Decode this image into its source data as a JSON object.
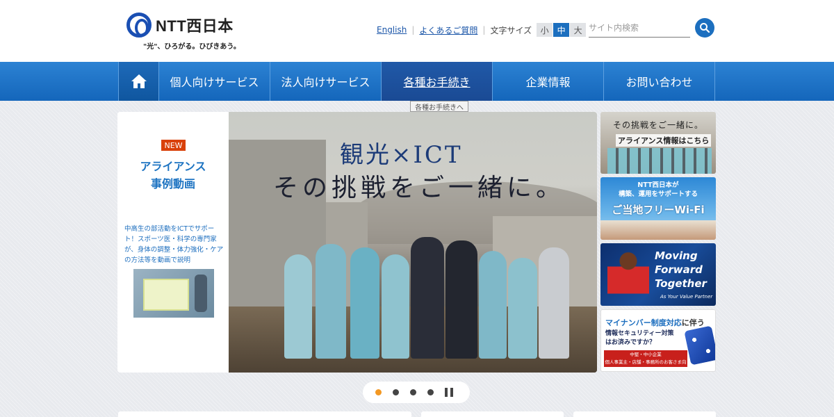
{
  "header": {
    "logo_text": "NTT西日本",
    "tagline": "\"光\"、ひろがる。ひびきあう。",
    "links": {
      "english": "English",
      "faq": "よくあるご質問"
    },
    "font_size": {
      "label": "文字サイズ",
      "small": "小",
      "medium": "中",
      "large": "大",
      "selected": "中"
    },
    "search": {
      "placeholder": "サイト内検索",
      "icon": "search-icon"
    }
  },
  "nav": {
    "home_icon": "home-icon",
    "items": [
      "個人向けサービス",
      "法人向けサービス",
      "各種お手続き",
      "企業情報",
      "お問い合わせ"
    ],
    "active_item": "各種お手続き",
    "tooltip": "各種お手続きへ"
  },
  "hero": {
    "badge": "NEW",
    "title_line1": "アライアンス",
    "title_line2": "事例動画",
    "description": "中高生の部活動をICTでサポート！スポーツ医・科学の専門家が、身体の調整・体力強化・ケアの方法等を動画で説明",
    "headline1": "観光×ICT",
    "headline2": "その挑戦をご一緒に。"
  },
  "banners": [
    {
      "line1": "その挑戦をご一緒に。",
      "line2": "アライアンス情報はこちら"
    },
    {
      "line1": "NTT西日本が",
      "line2": "構築、運用をサポートする",
      "line3": "ご当地フリーWi-Fi"
    },
    {
      "line1": "Moving",
      "line2": "Forward",
      "line3": "Together",
      "line4": "As Your Value Partner"
    },
    {
      "line1a": "マイナンバー制度対応",
      "line1b": "に伴う",
      "line2": "情報セキュリティー対策",
      "line3": "はお済みですか？",
      "strip1": "中堅・中小企業",
      "strip2": "個人事業主・店舗・事務所のお客さま向け"
    }
  ],
  "pager": {
    "count": 4,
    "active_index": 0,
    "pause_icon": "pause-icon"
  },
  "colors": {
    "brand_blue": "#1c6fbf",
    "nav_blue": "#1a6fc4",
    "badge_red": "#d9410a",
    "pager_active": "#f39823"
  }
}
